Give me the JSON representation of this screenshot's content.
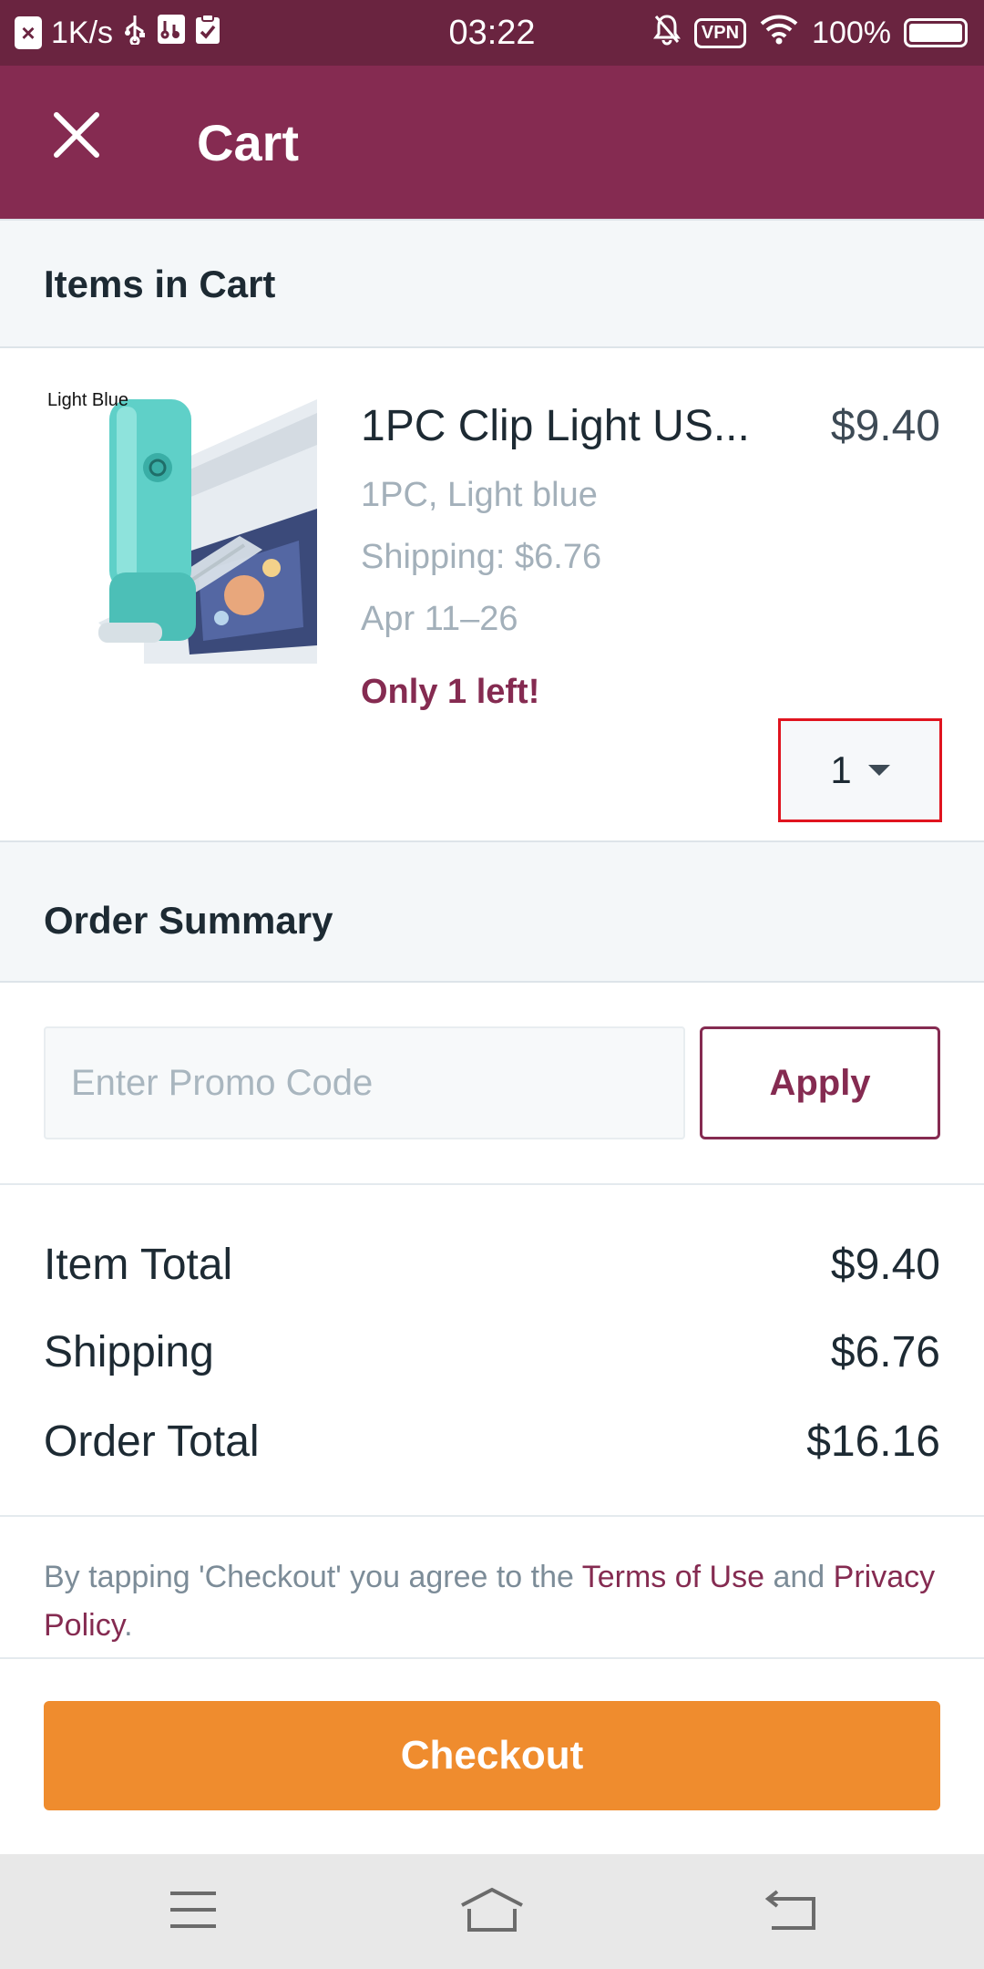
{
  "status_bar": {
    "speed": "1K/s",
    "time": "03:22",
    "vpn": "VPN",
    "battery": "100%"
  },
  "header": {
    "title": "Cart"
  },
  "cart_section": {
    "title": "Items in Cart"
  },
  "item": {
    "image_label": "Light Blue",
    "title": "1PC Clip Light US...",
    "price": "$9.40",
    "variant": "1PC, Light blue",
    "shipping": "Shipping: $6.76",
    "delivery": "Apr 11–26",
    "stock_alert": "Only 1 left!",
    "quantity": "1"
  },
  "summary_section": {
    "title": "Order Summary"
  },
  "promo": {
    "placeholder": "Enter Promo Code",
    "value": "",
    "apply_label": "Apply"
  },
  "totals": [
    {
      "label": "Item Total",
      "value": "$9.40"
    },
    {
      "label": "Shipping",
      "value": "$6.76"
    },
    {
      "label": "Order Total",
      "value": "$16.16"
    }
  ],
  "legal": {
    "prefix": "By tapping 'Checkout' you agree to the ",
    "terms_link": "Terms of Use",
    "conjunction": " and ",
    "privacy_link": "Privacy Policy",
    "suffix": "."
  },
  "checkout": {
    "label": "Checkout"
  },
  "colors": {
    "status_bar": "#6a2440",
    "brand": "#852b51",
    "checkout": "#ef8c2e",
    "selection_outline": "#e0141f"
  },
  "icons": {
    "close": "close-icon",
    "quantity_caret": "caret-down-icon",
    "nav_menu": "menu-icon",
    "nav_home": "home-icon",
    "nav_back": "back-icon"
  }
}
